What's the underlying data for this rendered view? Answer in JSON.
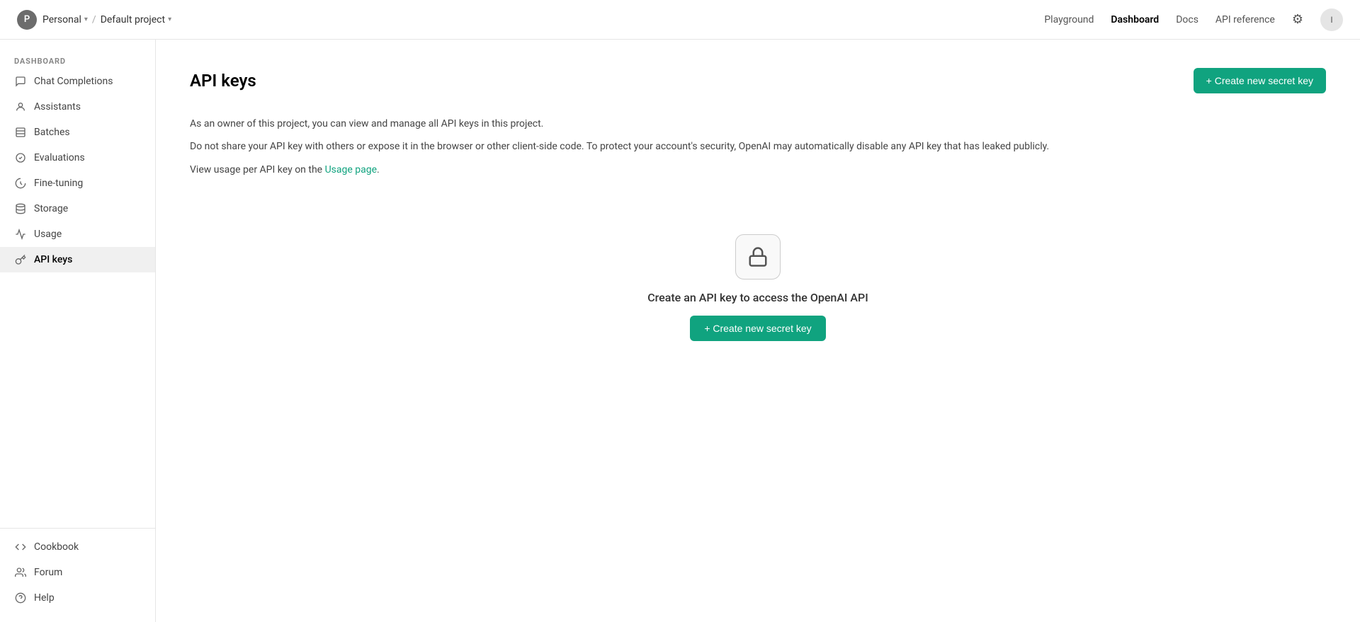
{
  "nav": {
    "avatar_letter": "P",
    "breadcrumb": {
      "org": "Personal",
      "project": "Default project"
    },
    "links": [
      {
        "label": "Playground",
        "active": false
      },
      {
        "label": "Dashboard",
        "active": true
      },
      {
        "label": "Docs",
        "active": false
      },
      {
        "label": "API reference",
        "active": false
      }
    ],
    "user_initial": "I"
  },
  "sidebar": {
    "section_label": "DASHBOARD",
    "items": [
      {
        "label": "Chat Completions",
        "icon": "chat",
        "active": false
      },
      {
        "label": "Assistants",
        "icon": "person",
        "active": false
      },
      {
        "label": "Batches",
        "icon": "batches",
        "active": false
      },
      {
        "label": "Evaluations",
        "icon": "evaluations",
        "active": false
      },
      {
        "label": "Fine-tuning",
        "icon": "finetune",
        "active": false
      },
      {
        "label": "Storage",
        "icon": "storage",
        "active": false
      },
      {
        "label": "Usage",
        "icon": "usage",
        "active": false
      },
      {
        "label": "API keys",
        "icon": "key",
        "active": true
      }
    ],
    "bottom_items": [
      {
        "label": "Cookbook",
        "icon": "code"
      },
      {
        "label": "Forum",
        "icon": "forum"
      },
      {
        "label": "Help",
        "icon": "help"
      }
    ]
  },
  "page": {
    "title": "API keys",
    "create_button_label": "+ Create new secret key",
    "info_line1": "As an owner of this project, you can view and manage all API keys in this project.",
    "info_line2": "Do not share your API key with others or expose it in the browser or other client-side code. To protect your account's security, OpenAI may automatically disable any API key that has leaked publicly.",
    "info_line3_prefix": "View usage per API key on the ",
    "info_link": "Usage page",
    "info_line3_suffix": ".",
    "empty_state_text": "Create an API key to access the OpenAI API",
    "center_button_label": "+ Create new secret key"
  }
}
